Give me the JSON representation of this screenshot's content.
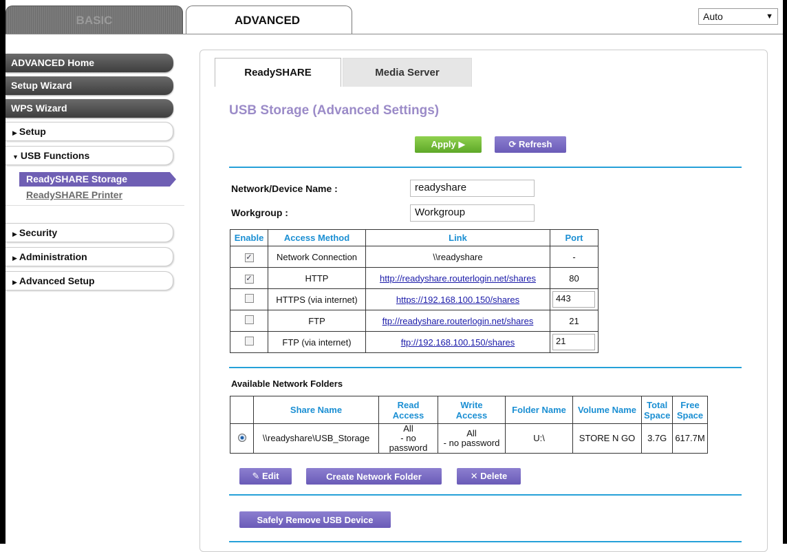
{
  "top_tabs": {
    "basic": "BASIC",
    "advanced": "ADVANCED"
  },
  "language": {
    "selected": "Auto"
  },
  "sidebar": {
    "advanced_home": "ADVANCED Home",
    "setup_wizard": "Setup Wizard",
    "wps_wizard": "WPS Wizard",
    "setup": "Setup",
    "usb_functions": "USB Functions",
    "readyshare_storage": "ReadySHARE Storage",
    "readyshare_printer": "ReadySHARE Printer",
    "security": "Security",
    "administration": "Administration",
    "advanced_setup": "Advanced Setup"
  },
  "content_tabs": {
    "readyshare": "ReadySHARE",
    "media_server": "Media Server"
  },
  "page_title": "USB Storage (Advanced Settings)",
  "buttons": {
    "apply": "Apply ▶",
    "refresh": "⟳ Refresh",
    "edit": "✎ Edit",
    "create_folder": "Create Network Folder",
    "delete": "✕ Delete",
    "safely_remove": "Safely Remove USB Device"
  },
  "form": {
    "device_name_label": "Network/Device Name :",
    "device_name_value": "readyshare",
    "workgroup_label": "Workgroup :",
    "workgroup_value": "Workgroup"
  },
  "access_table": {
    "headers": [
      "Enable",
      "Access Method",
      "Link",
      "Port"
    ],
    "rows": [
      {
        "checked": true,
        "method": "Network Connection",
        "link": "\\\\readyshare",
        "port": "-"
      },
      {
        "checked": true,
        "method": "HTTP",
        "link": "http://readyshare.routerlogin.net/shares",
        "port": "80"
      },
      {
        "checked": false,
        "method": "HTTPS (via internet)",
        "link": "https://192.168.100.150/shares",
        "port": "443"
      },
      {
        "checked": false,
        "method": "FTP",
        "link": "ftp://readyshare.routerlogin.net/shares",
        "port": "21"
      },
      {
        "checked": false,
        "method": "FTP (via internet)",
        "link": "ftp://192.168.100.150/shares",
        "port": "21"
      }
    ]
  },
  "folders": {
    "title": "Available Network Folders",
    "headers": {
      "share_name": "Share Name",
      "read_1": "Read",
      "read_2": "Access",
      "write_1": "Write",
      "write_2": "Access",
      "folder_name": "Folder Name",
      "volume_name": "Volume Name",
      "total_1": "Total",
      "total_2": "Space",
      "free_1": "Free",
      "free_2": "Space"
    },
    "row": {
      "share_name": "\\\\readyshare\\USB_Storage",
      "read_1": "All",
      "read_2": "- no password",
      "write_1": "All",
      "write_2": "- no password",
      "folder_name": "U:\\",
      "volume_name": "STORE N GO",
      "total": "3.7G",
      "free": "617.7M"
    }
  },
  "colors": {
    "accent_blue": "#25a0d8",
    "purple": "#6a5bb8",
    "apply_green": "#6cb52f",
    "title_lavender": "#9b8bc8"
  }
}
